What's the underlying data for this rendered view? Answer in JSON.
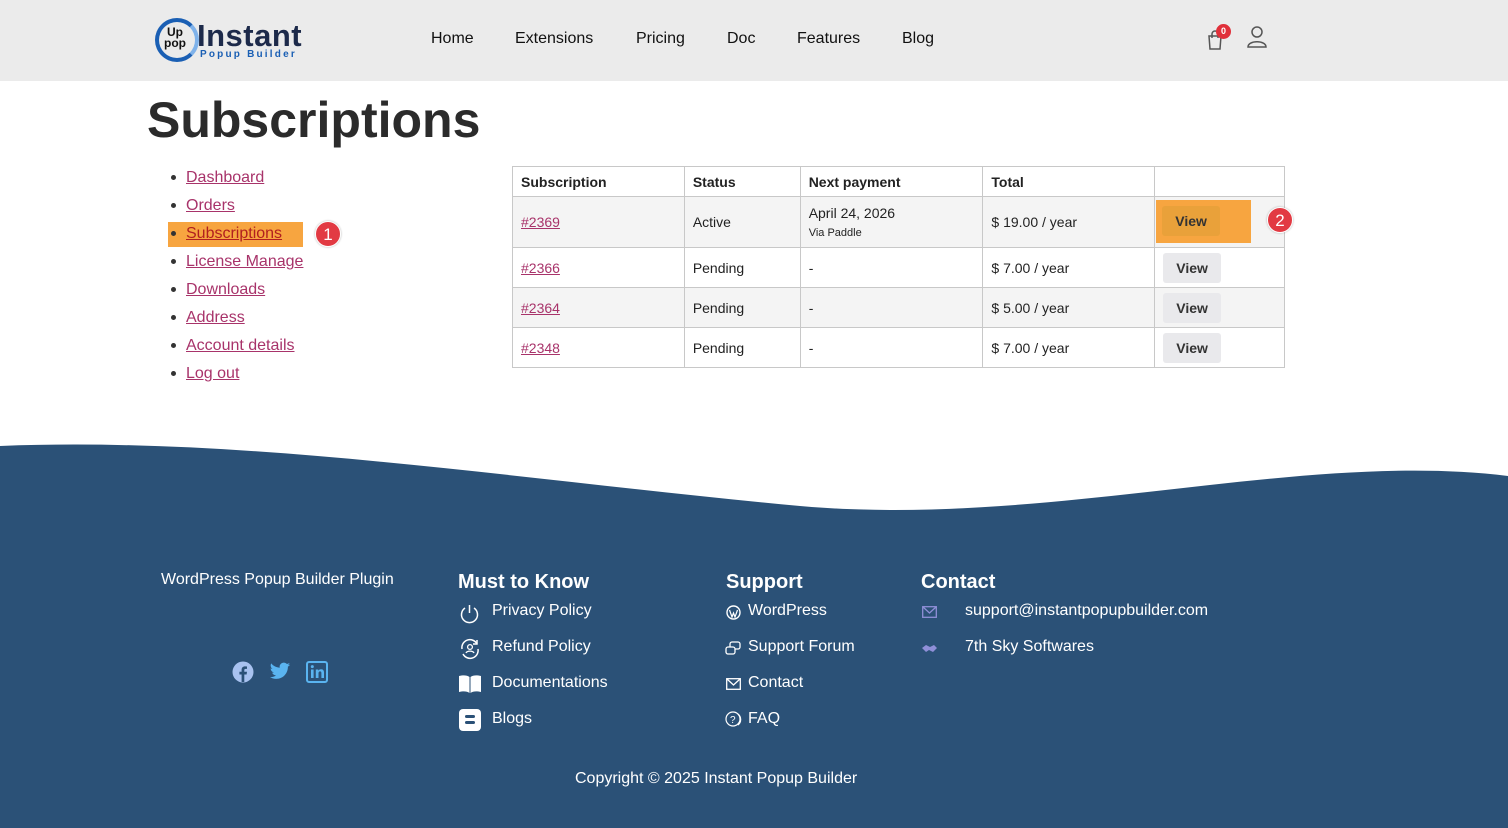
{
  "header": {
    "logo": {
      "up": "Up",
      "pop": "pop",
      "word": "Instant",
      "sub": "Popup Builder"
    },
    "nav": [
      "Home",
      "Extensions",
      "Pricing",
      "Doc",
      "Features",
      "Blog"
    ],
    "cart_count": "0"
  },
  "page_title": "Subscriptions",
  "account_nav": {
    "items": [
      "Dashboard",
      "Orders",
      "Subscriptions",
      "License Manage",
      "Downloads",
      "Address",
      "Account details",
      "Log out"
    ],
    "active": "Subscriptions"
  },
  "steps": {
    "one": "1",
    "two": "2"
  },
  "table": {
    "headers": [
      "Subscription",
      "Status",
      "Next payment",
      "Total",
      ""
    ],
    "rows": [
      {
        "id": "#2369",
        "status": "Active",
        "next": "April 24, 2026",
        "next_sub": "Via Paddle",
        "total": "$ 19.00 / year",
        "action": "View"
      },
      {
        "id": "#2366",
        "status": "Pending",
        "next": "-",
        "next_sub": "",
        "total": "$ 7.00 / year",
        "action": "View"
      },
      {
        "id": "#2364",
        "status": "Pending",
        "next": "-",
        "next_sub": "",
        "total": "$ 5.00 / year",
        "action": "View"
      },
      {
        "id": "#2348",
        "status": "Pending",
        "next": "-",
        "next_sub": "",
        "total": "$ 7.00 / year",
        "action": "View"
      }
    ]
  },
  "footer": {
    "tagline": "WordPress Popup Builder Plugin",
    "must_to_know": {
      "title": "Must to Know",
      "links": [
        "Privacy Policy",
        "Refund Policy",
        "Documentations",
        "Blogs"
      ]
    },
    "support": {
      "title": "Support",
      "links": [
        "WordPress",
        "Support Forum",
        "Contact",
        "FAQ"
      ]
    },
    "contact": {
      "title": "Contact",
      "email": "support@instantpopupbuilder.com",
      "company": "7th Sky Softwares"
    },
    "copyright": "Copyright © 2025 Instant Popup Builder"
  },
  "colors": {
    "footer_bg": "#2b5177",
    "highlight": "#f7a540",
    "link": "#a8336a",
    "step_badge": "#e23a43",
    "header_bg": "#ebebeb"
  }
}
